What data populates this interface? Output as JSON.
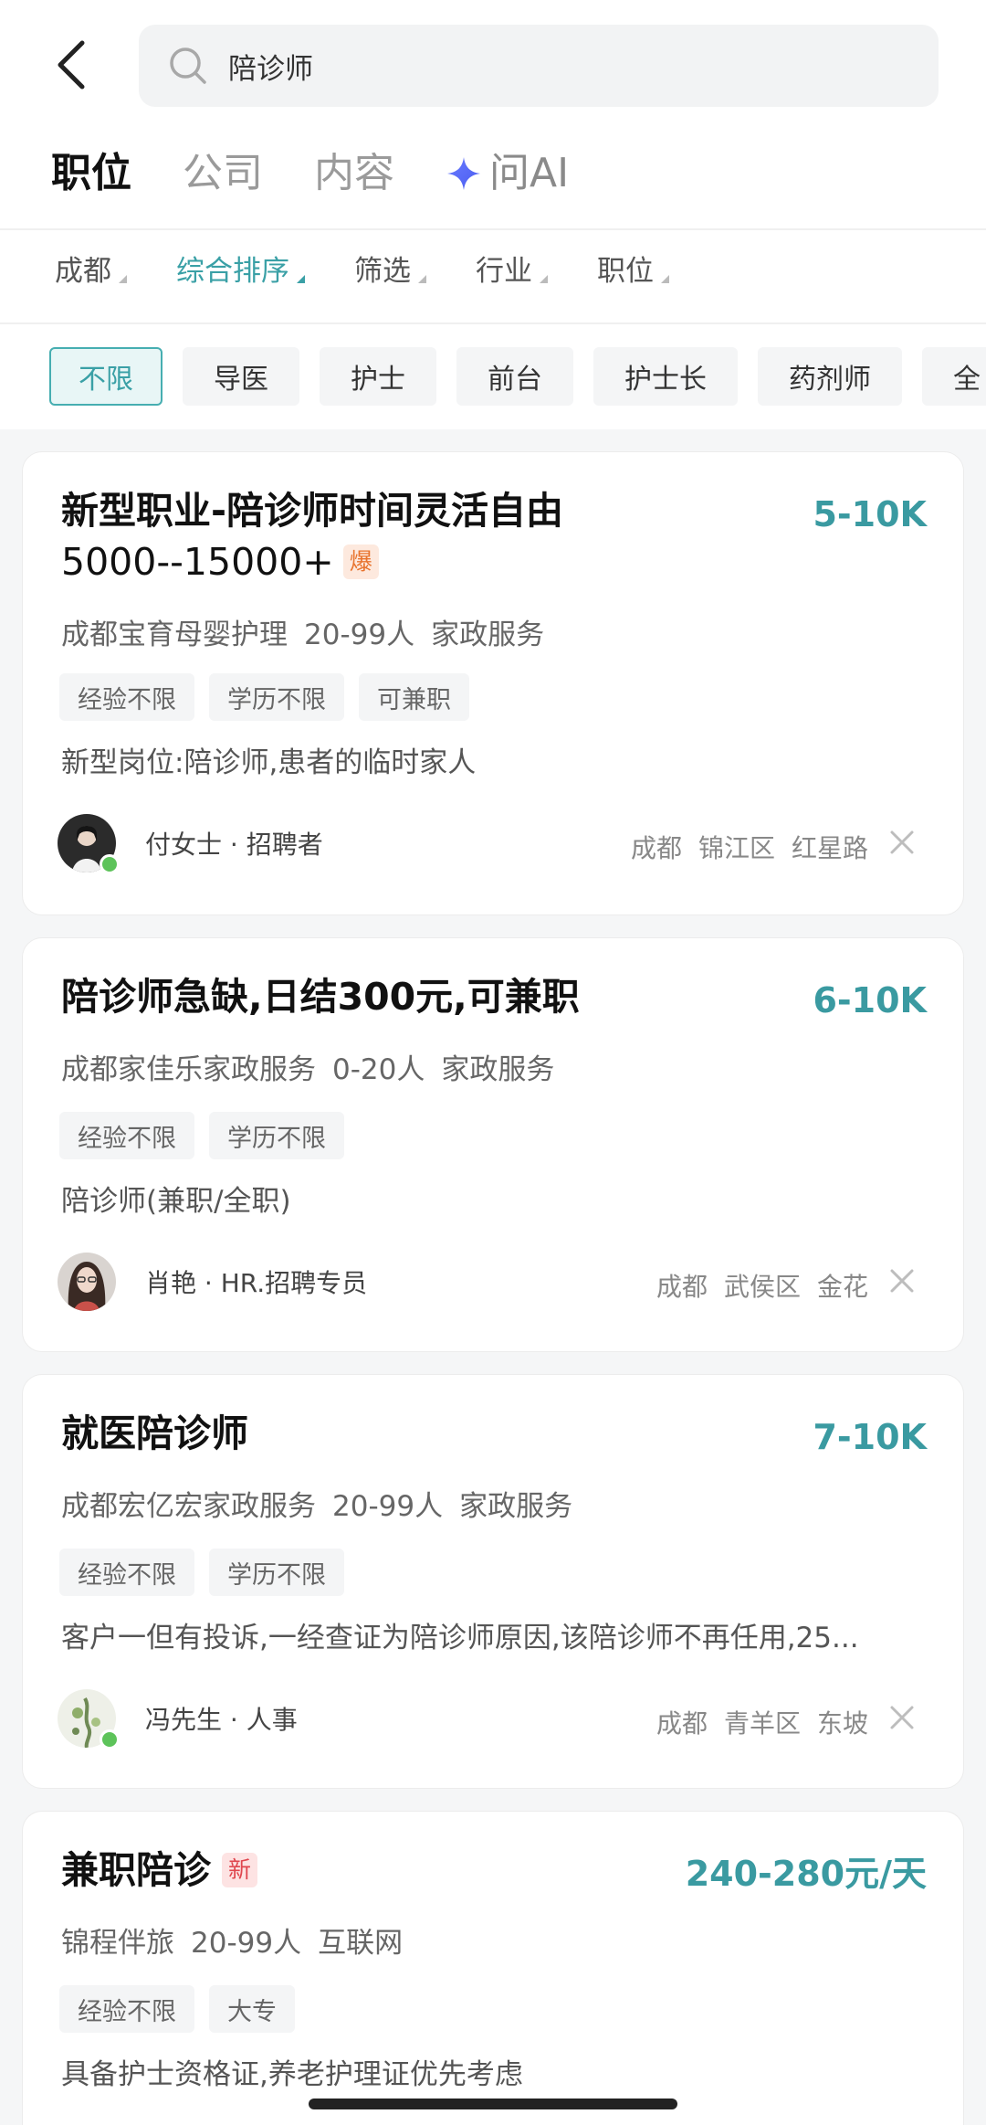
{
  "search": {
    "query": "陪诊师"
  },
  "top_tabs": [
    "职位",
    "公司",
    "内容",
    "问AI"
  ],
  "filters": [
    {
      "label": "成都",
      "active": false
    },
    {
      "label": "综合排序",
      "active": true
    },
    {
      "label": "筛选",
      "active": false
    },
    {
      "label": "行业",
      "active": false
    },
    {
      "label": "职位",
      "active": false
    }
  ],
  "chips": [
    "不限",
    "导医",
    "护士",
    "前台",
    "护士长",
    "药剂师",
    "全"
  ],
  "colors": {
    "accent": "#3aa0a6",
    "salary": "#3a9aa1",
    "hot_badge": "#e8732d",
    "new_badge": "#e0474f",
    "online": "#5dc35a"
  },
  "jobs": [
    {
      "title_line1": "新型职业-陪诊师时间灵活自由",
      "title_line2": "5000--15000+",
      "badge": "爆",
      "salary": "5-10K",
      "company": "成都宝育母婴护理",
      "size": "20-99人",
      "industry": "家政服务",
      "tags": [
        "经验不限",
        "学历不限",
        "可兼职"
      ],
      "desc": "新型岗位:陪诊师,患者的临时家人",
      "recruiter": "付女士 · 招聘者",
      "online": true,
      "location": [
        "成都",
        "锦江区",
        "红星路"
      ]
    },
    {
      "title_line1": "陪诊师急缺,日结300元,可兼职",
      "salary": "6-10K",
      "company": "成都家佳乐家政服务",
      "size": "0-20人",
      "industry": "家政服务",
      "tags": [
        "经验不限",
        "学历不限"
      ],
      "desc": "陪诊师(兼职/全职)",
      "recruiter": "肖艳 · HR.招聘专员",
      "online": false,
      "location": [
        "成都",
        "武侯区",
        "金花"
      ]
    },
    {
      "title_line1": "就医陪诊师",
      "salary": "7-10K",
      "company": "成都宏亿宏家政服务",
      "size": "20-99人",
      "industry": "家政服务",
      "tags": [
        "经验不限",
        "学历不限"
      ],
      "desc": "客户一但有投诉,一经查证为陪诊师原因,该陪诊师不再任用,25...",
      "recruiter": "冯先生 · 人事",
      "online": true,
      "location": [
        "成都",
        "青羊区",
        "东坡"
      ]
    },
    {
      "title_line1": "兼职陪诊",
      "badge": "新",
      "salary": "240-280元/天",
      "company": "锦程伴旅",
      "size": "20-99人",
      "industry": "互联网",
      "tags": [
        "经验不限",
        "大专"
      ],
      "desc": "具备护士资格证,养老护理证优先考虑"
    }
  ]
}
